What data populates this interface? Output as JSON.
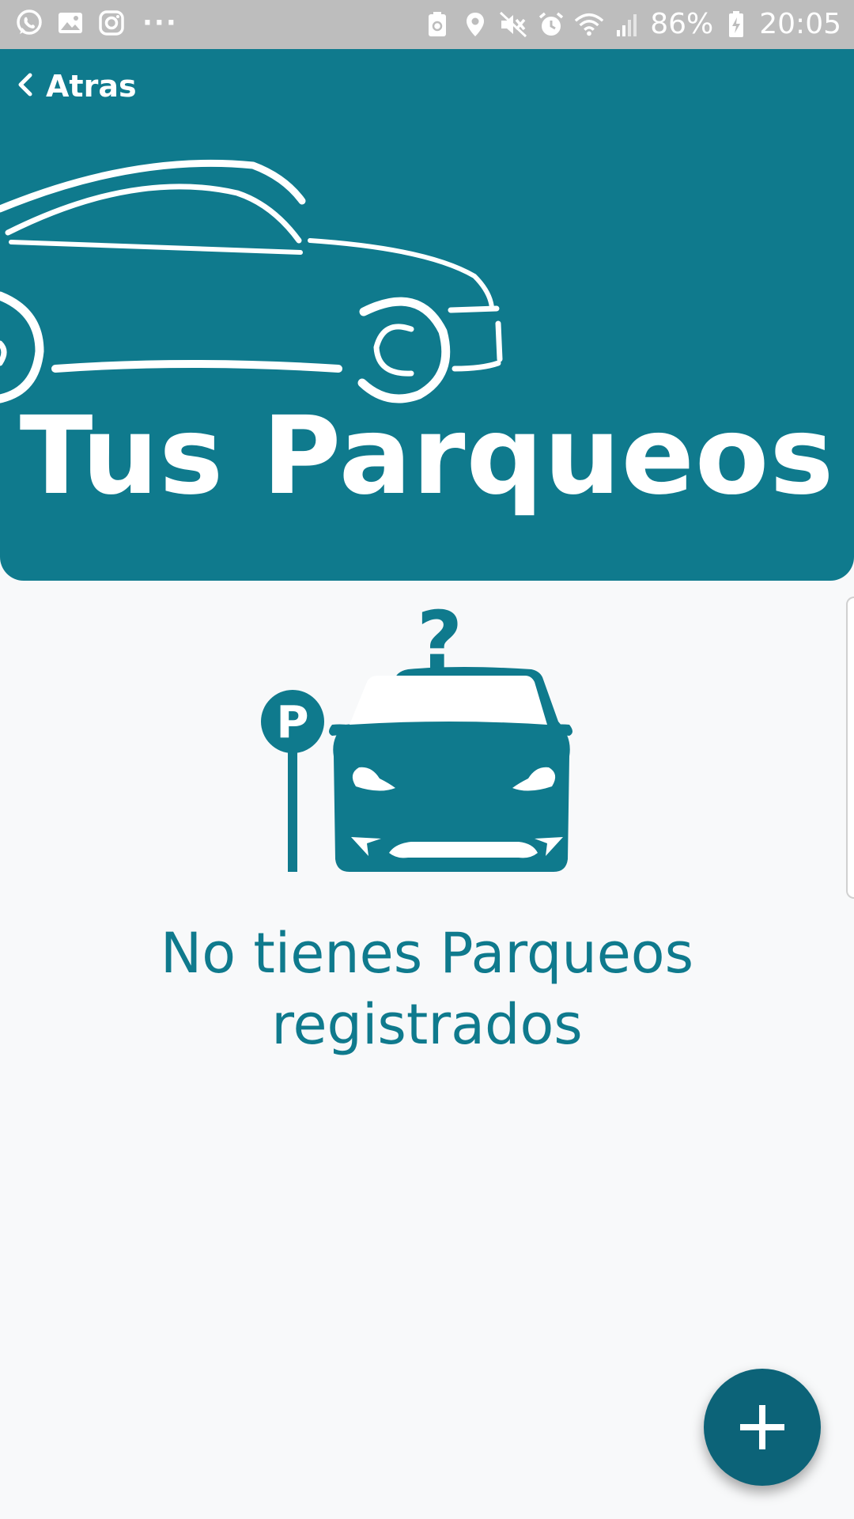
{
  "status_bar": {
    "left_icons": [
      "whatsapp-icon",
      "gallery-icon",
      "instagram-icon",
      "more-notifications-icon"
    ],
    "more_glyph": "···",
    "right_icons": [
      "nfc-icon",
      "location-icon",
      "mute-icon",
      "alarm-icon",
      "wifi-icon",
      "signal-icon",
      "battery-charging-icon"
    ],
    "battery": "86%",
    "time": "20:05"
  },
  "header": {
    "back_label": "Atras",
    "title": "Tus Parqueos"
  },
  "empty_state": {
    "line1": "No tienes Parqueos",
    "line2": "registrados",
    "icon": "parking-car-question-icon"
  },
  "fab": {
    "icon": "plus-icon"
  },
  "colors": {
    "brand": "#0f7a8d",
    "fab": "#0c6378",
    "status_bar": "#bdbdbd",
    "background": "#f8f9fa"
  }
}
